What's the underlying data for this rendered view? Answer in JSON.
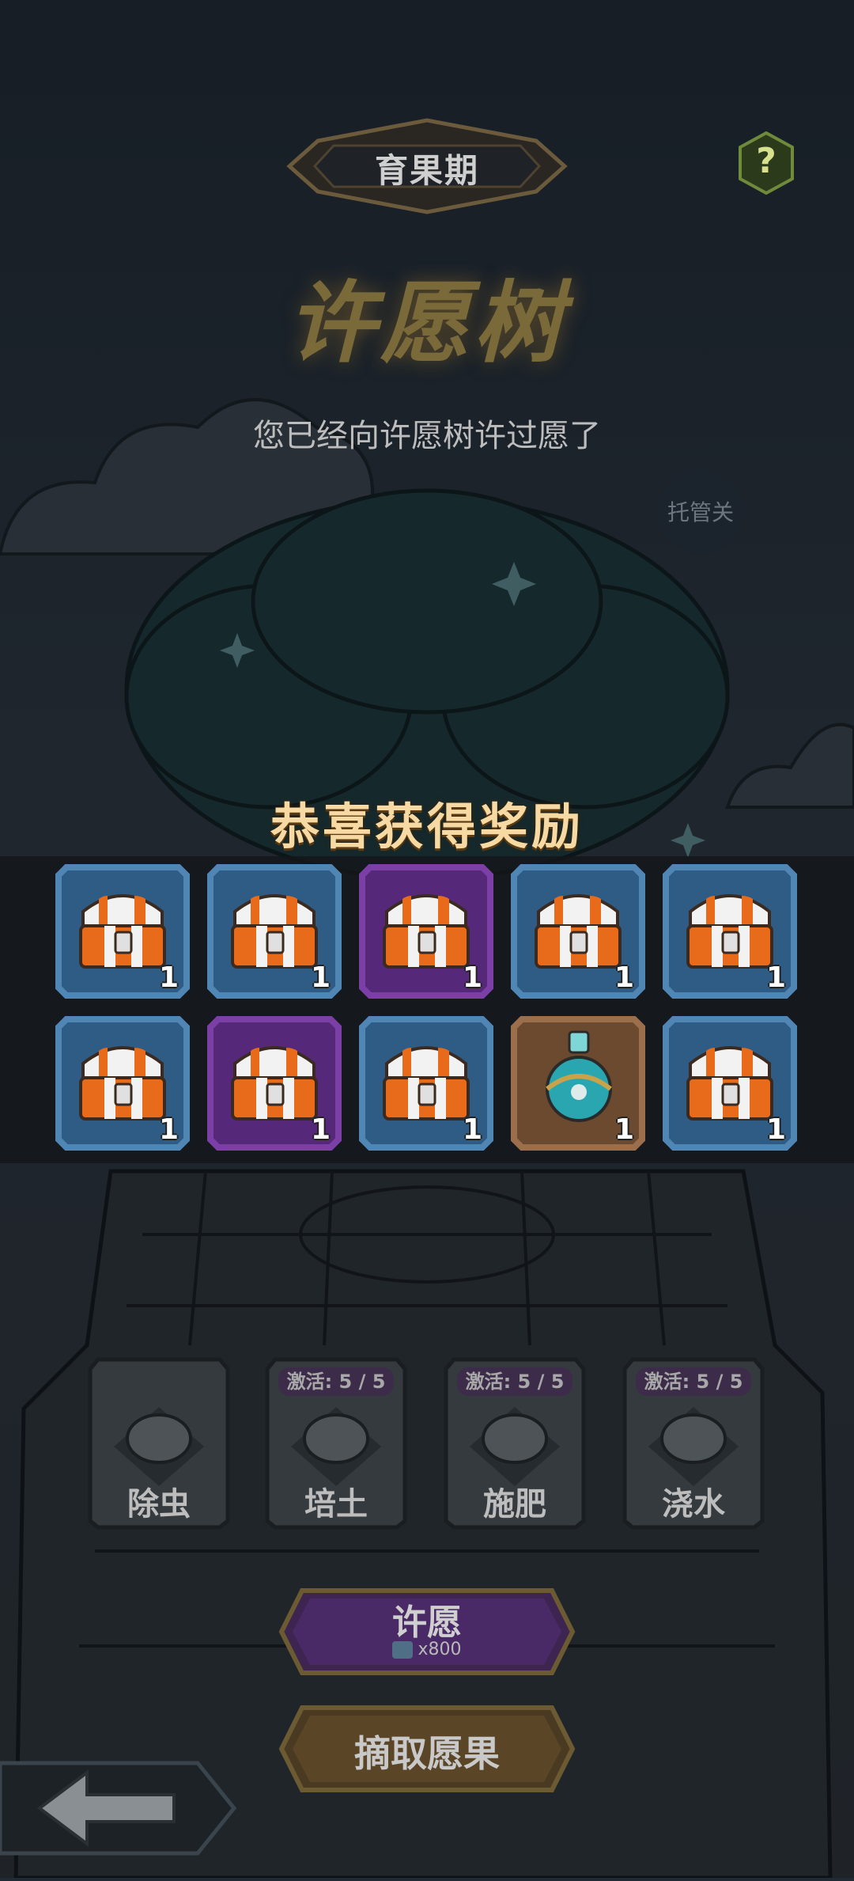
{
  "header": {
    "stage": "育果期",
    "help": "?"
  },
  "title": "许愿树",
  "subtitle": "您已经向许愿树许过愿了",
  "auto_button": "托管关",
  "reward": {
    "title": "恭喜获得奖励",
    "items": [
      {
        "type": "chest",
        "frame": "blue",
        "qty": "1"
      },
      {
        "type": "chest",
        "frame": "blue",
        "qty": "1"
      },
      {
        "type": "chest",
        "frame": "purple",
        "qty": "1"
      },
      {
        "type": "chest",
        "frame": "blue",
        "qty": "1"
      },
      {
        "type": "chest",
        "frame": "blue",
        "qty": "1"
      },
      {
        "type": "chest",
        "frame": "blue",
        "qty": "1"
      },
      {
        "type": "chest",
        "frame": "purple",
        "qty": "1"
      },
      {
        "type": "chest",
        "frame": "blue",
        "qty": "1"
      },
      {
        "type": "potion",
        "frame": "bronze",
        "qty": "1"
      },
      {
        "type": "chest",
        "frame": "blue",
        "qty": "1"
      }
    ]
  },
  "actions": [
    {
      "label": "除虫",
      "badge": ""
    },
    {
      "label": "培土",
      "badge": "激活: 5 / 5"
    },
    {
      "label": "施肥",
      "badge": "激活: 5 / 5"
    },
    {
      "label": "浇水",
      "badge": "激活: 5 / 5"
    }
  ],
  "wish_button": {
    "label": "许愿",
    "cost": "x800"
  },
  "pick_button": {
    "label": "摘取愿果"
  },
  "colors": {
    "blue_frame": "#4f86b4",
    "purple_frame": "#7b3fa6",
    "bronze_frame": "#9b6e4c",
    "chest_orange": "#e76b1a",
    "reward_text": "#f7d9a3"
  }
}
